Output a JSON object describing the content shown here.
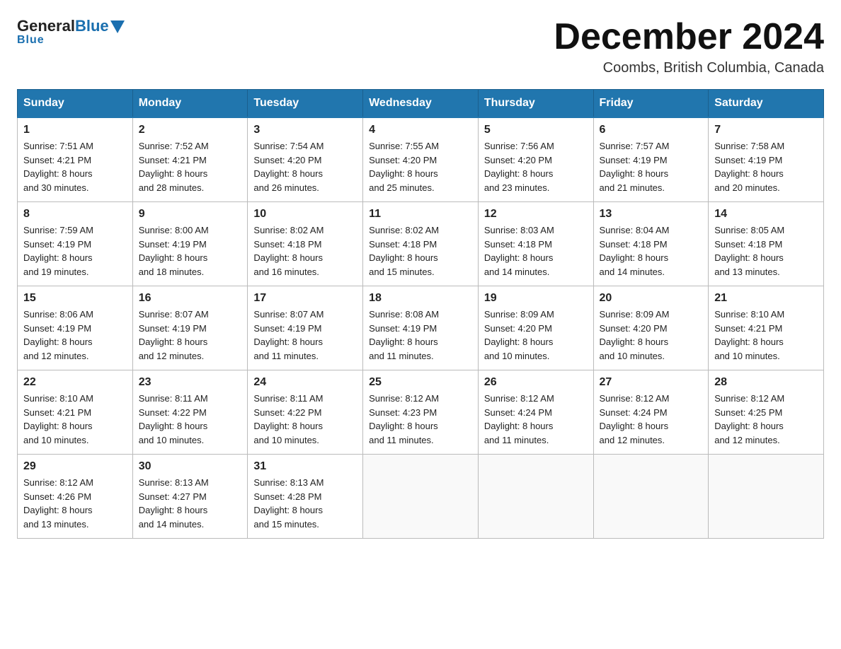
{
  "header": {
    "logo_general": "General",
    "logo_blue": "Blue",
    "month_title": "December 2024",
    "location": "Coombs, British Columbia, Canada"
  },
  "days_of_week": [
    "Sunday",
    "Monday",
    "Tuesday",
    "Wednesday",
    "Thursday",
    "Friday",
    "Saturday"
  ],
  "weeks": [
    [
      {
        "day": "1",
        "sunrise": "7:51 AM",
        "sunset": "4:21 PM",
        "daylight": "8 hours and 30 minutes."
      },
      {
        "day": "2",
        "sunrise": "7:52 AM",
        "sunset": "4:21 PM",
        "daylight": "8 hours and 28 minutes."
      },
      {
        "day": "3",
        "sunrise": "7:54 AM",
        "sunset": "4:20 PM",
        "daylight": "8 hours and 26 minutes."
      },
      {
        "day": "4",
        "sunrise": "7:55 AM",
        "sunset": "4:20 PM",
        "daylight": "8 hours and 25 minutes."
      },
      {
        "day": "5",
        "sunrise": "7:56 AM",
        "sunset": "4:20 PM",
        "daylight": "8 hours and 23 minutes."
      },
      {
        "day": "6",
        "sunrise": "7:57 AM",
        "sunset": "4:19 PM",
        "daylight": "8 hours and 21 minutes."
      },
      {
        "day": "7",
        "sunrise": "7:58 AM",
        "sunset": "4:19 PM",
        "daylight": "8 hours and 20 minutes."
      }
    ],
    [
      {
        "day": "8",
        "sunrise": "7:59 AM",
        "sunset": "4:19 PM",
        "daylight": "8 hours and 19 minutes."
      },
      {
        "day": "9",
        "sunrise": "8:00 AM",
        "sunset": "4:19 PM",
        "daylight": "8 hours and 18 minutes."
      },
      {
        "day": "10",
        "sunrise": "8:02 AM",
        "sunset": "4:18 PM",
        "daylight": "8 hours and 16 minutes."
      },
      {
        "day": "11",
        "sunrise": "8:02 AM",
        "sunset": "4:18 PM",
        "daylight": "8 hours and 15 minutes."
      },
      {
        "day": "12",
        "sunrise": "8:03 AM",
        "sunset": "4:18 PM",
        "daylight": "8 hours and 14 minutes."
      },
      {
        "day": "13",
        "sunrise": "8:04 AM",
        "sunset": "4:18 PM",
        "daylight": "8 hours and 14 minutes."
      },
      {
        "day": "14",
        "sunrise": "8:05 AM",
        "sunset": "4:18 PM",
        "daylight": "8 hours and 13 minutes."
      }
    ],
    [
      {
        "day": "15",
        "sunrise": "8:06 AM",
        "sunset": "4:19 PM",
        "daylight": "8 hours and 12 minutes."
      },
      {
        "day": "16",
        "sunrise": "8:07 AM",
        "sunset": "4:19 PM",
        "daylight": "8 hours and 12 minutes."
      },
      {
        "day": "17",
        "sunrise": "8:07 AM",
        "sunset": "4:19 PM",
        "daylight": "8 hours and 11 minutes."
      },
      {
        "day": "18",
        "sunrise": "8:08 AM",
        "sunset": "4:19 PM",
        "daylight": "8 hours and 11 minutes."
      },
      {
        "day": "19",
        "sunrise": "8:09 AM",
        "sunset": "4:20 PM",
        "daylight": "8 hours and 10 minutes."
      },
      {
        "day": "20",
        "sunrise": "8:09 AM",
        "sunset": "4:20 PM",
        "daylight": "8 hours and 10 minutes."
      },
      {
        "day": "21",
        "sunrise": "8:10 AM",
        "sunset": "4:21 PM",
        "daylight": "8 hours and 10 minutes."
      }
    ],
    [
      {
        "day": "22",
        "sunrise": "8:10 AM",
        "sunset": "4:21 PM",
        "daylight": "8 hours and 10 minutes."
      },
      {
        "day": "23",
        "sunrise": "8:11 AM",
        "sunset": "4:22 PM",
        "daylight": "8 hours and 10 minutes."
      },
      {
        "day": "24",
        "sunrise": "8:11 AM",
        "sunset": "4:22 PM",
        "daylight": "8 hours and 10 minutes."
      },
      {
        "day": "25",
        "sunrise": "8:12 AM",
        "sunset": "4:23 PM",
        "daylight": "8 hours and 11 minutes."
      },
      {
        "day": "26",
        "sunrise": "8:12 AM",
        "sunset": "4:24 PM",
        "daylight": "8 hours and 11 minutes."
      },
      {
        "day": "27",
        "sunrise": "8:12 AM",
        "sunset": "4:24 PM",
        "daylight": "8 hours and 12 minutes."
      },
      {
        "day": "28",
        "sunrise": "8:12 AM",
        "sunset": "4:25 PM",
        "daylight": "8 hours and 12 minutes."
      }
    ],
    [
      {
        "day": "29",
        "sunrise": "8:12 AM",
        "sunset": "4:26 PM",
        "daylight": "8 hours and 13 minutes."
      },
      {
        "day": "30",
        "sunrise": "8:13 AM",
        "sunset": "4:27 PM",
        "daylight": "8 hours and 14 minutes."
      },
      {
        "day": "31",
        "sunrise": "8:13 AM",
        "sunset": "4:28 PM",
        "daylight": "8 hours and 15 minutes."
      },
      null,
      null,
      null,
      null
    ]
  ],
  "labels": {
    "sunrise": "Sunrise:",
    "sunset": "Sunset:",
    "daylight": "Daylight:"
  }
}
